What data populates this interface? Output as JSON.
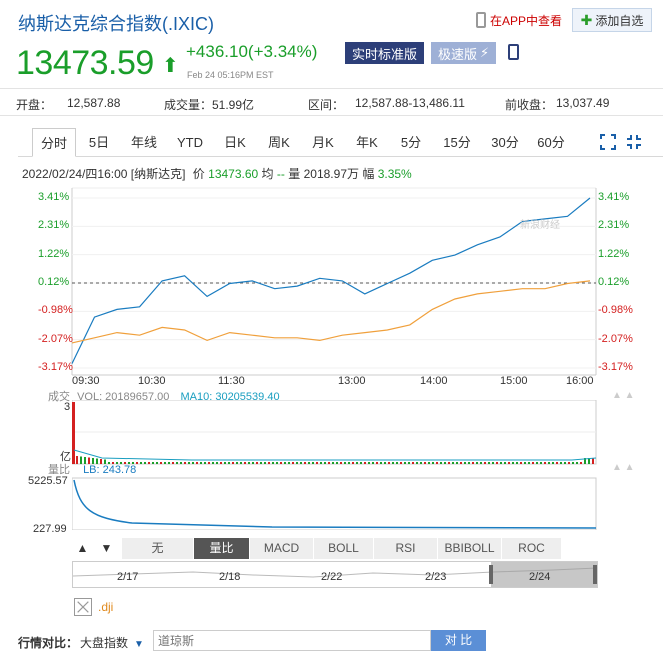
{
  "header": {
    "title": "纳斯达克综合指数(.IXIC)",
    "app_link": "在APP中查看",
    "add_fav": "添加自选",
    "price": "13473.59",
    "change": "+436.10(+3.34%)",
    "timestamp": "Feb 24 05:16PM EST",
    "badge_realtime": "实时标准版",
    "badge_fast": "极速版"
  },
  "stats": {
    "open_label": "开盘：",
    "open_value": "12,587.88",
    "volume_label": "成交量：",
    "volume_value": "51.99亿",
    "range_label": "区间：",
    "range_value": "12,587.88-13,486.11",
    "prev_label": "前收盘：",
    "prev_value": "13,037.49"
  },
  "tabs": [
    "分时",
    "5日",
    "年线",
    "YTD",
    "日K",
    "周K",
    "月K",
    "年K",
    "5分",
    "15分",
    "30分",
    "60分"
  ],
  "info_line": {
    "date": "2022/02/24/四16:00 [纳斯达克]",
    "price_label": "价",
    "price": "13473.60",
    "avg_label": "均",
    "avg": "--",
    "vol_label": "量",
    "vol": "2018.97万",
    "amp_label": "幅",
    "amp": "3.35%"
  },
  "chart_data": {
    "type": "line",
    "y_percent_ticks": [
      "3.41%",
      "2.31%",
      "1.22%",
      "0.12%",
      "-0.98%",
      "-2.07%",
      "-3.17%"
    ],
    "x_ticks": [
      "09:30",
      "10:30",
      "11:30",
      "13:00",
      "14:00",
      "15:00",
      "16:00"
    ],
    "ylim_percent": [
      -3.17,
      3.41
    ],
    "baseline_percent": 0.12,
    "series": [
      {
        "color": "#1a7cc0",
        "values": [
          -3.0,
          -1.2,
          -0.9,
          -0.8,
          0.2,
          0.4,
          -0.4,
          0.1,
          0.2,
          -0.1,
          0.0,
          0.3,
          0.2,
          -0.3,
          0.1,
          0.5,
          1.0,
          1.2,
          1.6,
          1.9,
          2.5,
          2.6,
          2.7,
          3.41
        ]
      },
      {
        "color": "#f0a03c",
        "values": [
          -2.2,
          -2.0,
          -1.8,
          -1.9,
          -1.6,
          -1.7,
          -2.1,
          -1.8,
          -1.9,
          -2.0,
          -2.0,
          -2.1,
          -1.9,
          -1.8,
          -1.7,
          -1.5,
          -0.9,
          -0.5,
          -0.3,
          -0.2,
          -0.1,
          -0.1,
          0.1,
          0.2
        ]
      }
    ]
  },
  "volume": {
    "label": "成交",
    "vol_text": "VOL: 20189657.00",
    "ma_text": "MA10: 30205539.40",
    "top_tick": "3",
    "unit": "亿",
    "lb_label": "量比",
    "lb_text": "LB: 243.78",
    "lb_top": "5225.57",
    "lb_bottom": "227.99"
  },
  "indicators": [
    "无",
    "量比",
    "MACD",
    "BOLL",
    "RSI",
    "BBIBOLL",
    "ROC"
  ],
  "date_range": [
    "2/17",
    "2/18",
    "2/22",
    "2/23",
    "2/24"
  ],
  "compare": {
    "dji_label": ".dji",
    "label": "行情对比：",
    "select": "大盘指数",
    "input_placeholder": "道琼斯",
    "button": "对 比"
  },
  "colors": {
    "up_green": "#1a9e2a",
    "down_red": "#d42020",
    "brand_blue": "#1a5fa8"
  }
}
